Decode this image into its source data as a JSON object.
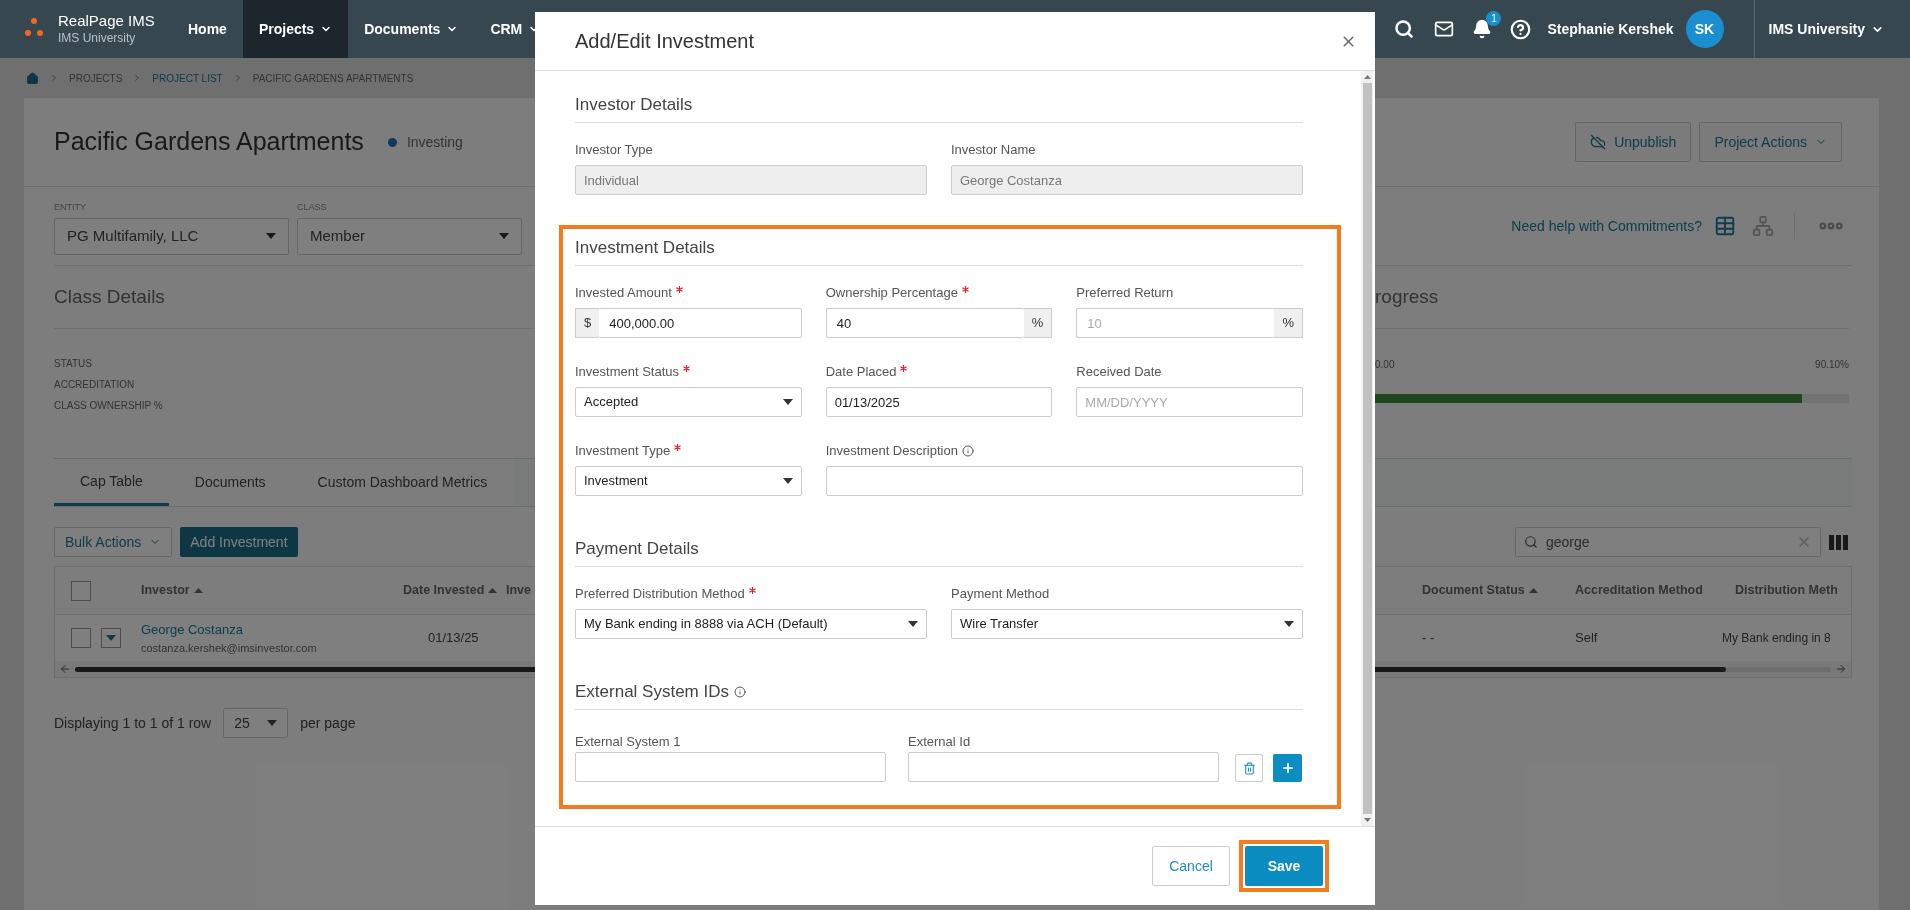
{
  "nav": {
    "brand": "RealPage IMS",
    "subtitle": "IMS University",
    "items": [
      {
        "label": "Home",
        "selected": false,
        "dropdown": false
      },
      {
        "label": "Projects",
        "selected": true,
        "dropdown": true
      },
      {
        "label": "Documents",
        "selected": false,
        "dropdown": true
      },
      {
        "label": "CRM",
        "selected": false,
        "dropdown": true
      }
    ],
    "notification_count": "1",
    "user_name": "Stephanie Kershek",
    "avatar_initials": "SK",
    "org_menu": "IMS University"
  },
  "breadcrumb": [
    {
      "label": "PROJECTS",
      "link": false
    },
    {
      "label": "PROJECT LIST",
      "link": true
    },
    {
      "label": "PACIFIC GARDENS APARTMENTS",
      "link": false
    }
  ],
  "project": {
    "title": "Pacific Gardens Apartments",
    "status": "Investing"
  },
  "header_actions": [
    {
      "label": "Unpublish",
      "kind": "icon"
    },
    {
      "label": "Project Actions",
      "kind": "dropdown"
    }
  ],
  "filters": [
    {
      "label": "ENTITY",
      "value": "PG Multifamily, LLC"
    },
    {
      "label": "CLASS",
      "value": "Member"
    }
  ],
  "help_link": "Need help with Commitments?",
  "class_details": {
    "title": "Class Details",
    "fields": [
      "STATUS",
      "ACCREDITATION",
      "CLASS OWNERSHIP %"
    ]
  },
  "progress": {
    "title": "rogress",
    "amount": "0.00",
    "percent": "90.10%",
    "level": 0.901
  },
  "tabs": [
    {
      "label": "Cap Table",
      "selected": true
    },
    {
      "label": "Documents",
      "selected": false
    },
    {
      "label": "Custom Dashboard Metrics",
      "selected": false
    }
  ],
  "toolbar": {
    "bulk_actions": "Bulk Actions",
    "add_button": "Add Investment",
    "search_value": "george"
  },
  "table": {
    "columns_left": [
      {
        "label": "Investor",
        "sortable": true
      },
      {
        "label": "Date Invested",
        "sortable": true
      },
      {
        "label": "Inve",
        "sortable": false
      }
    ],
    "columns_right": [
      {
        "label": "Document Status",
        "sortable": true
      },
      {
        "label": "Accreditation Method",
        "sortable": false
      },
      {
        "label": "Distribution Meth",
        "sortable": false
      }
    ],
    "all_selected": false,
    "rows": [
      {
        "selected": false,
        "investor": "George Costanza",
        "email": "costanza.kershek@imsinvestor.com",
        "date_invested": "01/13/25",
        "document_status": "- -",
        "accreditation_method": "Self",
        "distribution_method": "My Bank ending in 8"
      }
    ]
  },
  "pagination": {
    "summary": "Displaying 1 to 1 of 1 row",
    "page_size": "25",
    "suffix": "per page"
  },
  "modal": {
    "title": "Add/Edit Investment",
    "sections": [
      {
        "title": "Investor Details",
        "info": false,
        "highlighted": false,
        "kind": "grid2",
        "fields": [
          {
            "label": "Investor Type",
            "kind": "text",
            "value": "Individual",
            "disabled": true,
            "required": false,
            "info": false,
            "wide": false
          },
          {
            "label": "Investor Name",
            "kind": "text",
            "value": "George Costanza",
            "disabled": true,
            "required": false,
            "info": false,
            "wide": false
          }
        ]
      },
      {
        "title": "Investment Details",
        "info": false,
        "highlighted": true,
        "kind": "grid3",
        "fields": [
          {
            "label": "Invested Amount",
            "kind": "prefix",
            "addon": "$",
            "value": "400,000.00",
            "disabled": false,
            "required": true,
            "info": false,
            "wide": false
          },
          {
            "label": "Ownership Percentage",
            "kind": "suffix",
            "addon": "%",
            "value": "40",
            "disabled": false,
            "required": true,
            "info": false,
            "wide": false
          },
          {
            "label": "Preferred Return",
            "kind": "suffix",
            "addon": "%",
            "placeholder": "10",
            "disabled": false,
            "required": false,
            "info": false,
            "wide": false
          },
          {
            "label": "Investment Status",
            "kind": "select",
            "value": "Accepted",
            "disabled": false,
            "required": true,
            "info": false,
            "wide": false
          },
          {
            "label": "Date Placed",
            "kind": "text",
            "value": "01/13/2025",
            "disabled": false,
            "required": true,
            "info": false,
            "wide": false
          },
          {
            "label": "Received Date",
            "kind": "text",
            "placeholder": "MM/DD/YYYY",
            "disabled": false,
            "required": false,
            "info": false,
            "wide": false
          },
          {
            "label": "Investment Type",
            "kind": "select",
            "value": "Investment",
            "disabled": false,
            "required": true,
            "info": false,
            "wide": false
          },
          {
            "label": "Investment Description",
            "kind": "text",
            "disabled": false,
            "required": false,
            "info": true,
            "wide": true
          }
        ]
      },
      {
        "title": "Payment Details",
        "info": false,
        "highlighted": true,
        "kind": "grid2",
        "fields": [
          {
            "label": "Preferred Distribution Method",
            "kind": "select",
            "value": "My Bank ending in 8888 via ACH (Default)",
            "disabled": false,
            "required": true,
            "info": false,
            "wide": false
          },
          {
            "label": "Payment Method",
            "kind": "select",
            "value": "Wire Transfer",
            "disabled": false,
            "required": false,
            "info": false,
            "wide": false
          }
        ]
      },
      {
        "title": "External System IDs",
        "info": true,
        "highlighted": true,
        "kind": "external",
        "rows": [
          {
            "system_label": "External System 1",
            "id_label": "External Id"
          }
        ]
      }
    ],
    "buttons": [
      {
        "label": "Cancel",
        "kind": "secondary",
        "highlighted": false
      },
      {
        "label": "Save",
        "kind": "primary",
        "highlighted": true
      }
    ]
  }
}
